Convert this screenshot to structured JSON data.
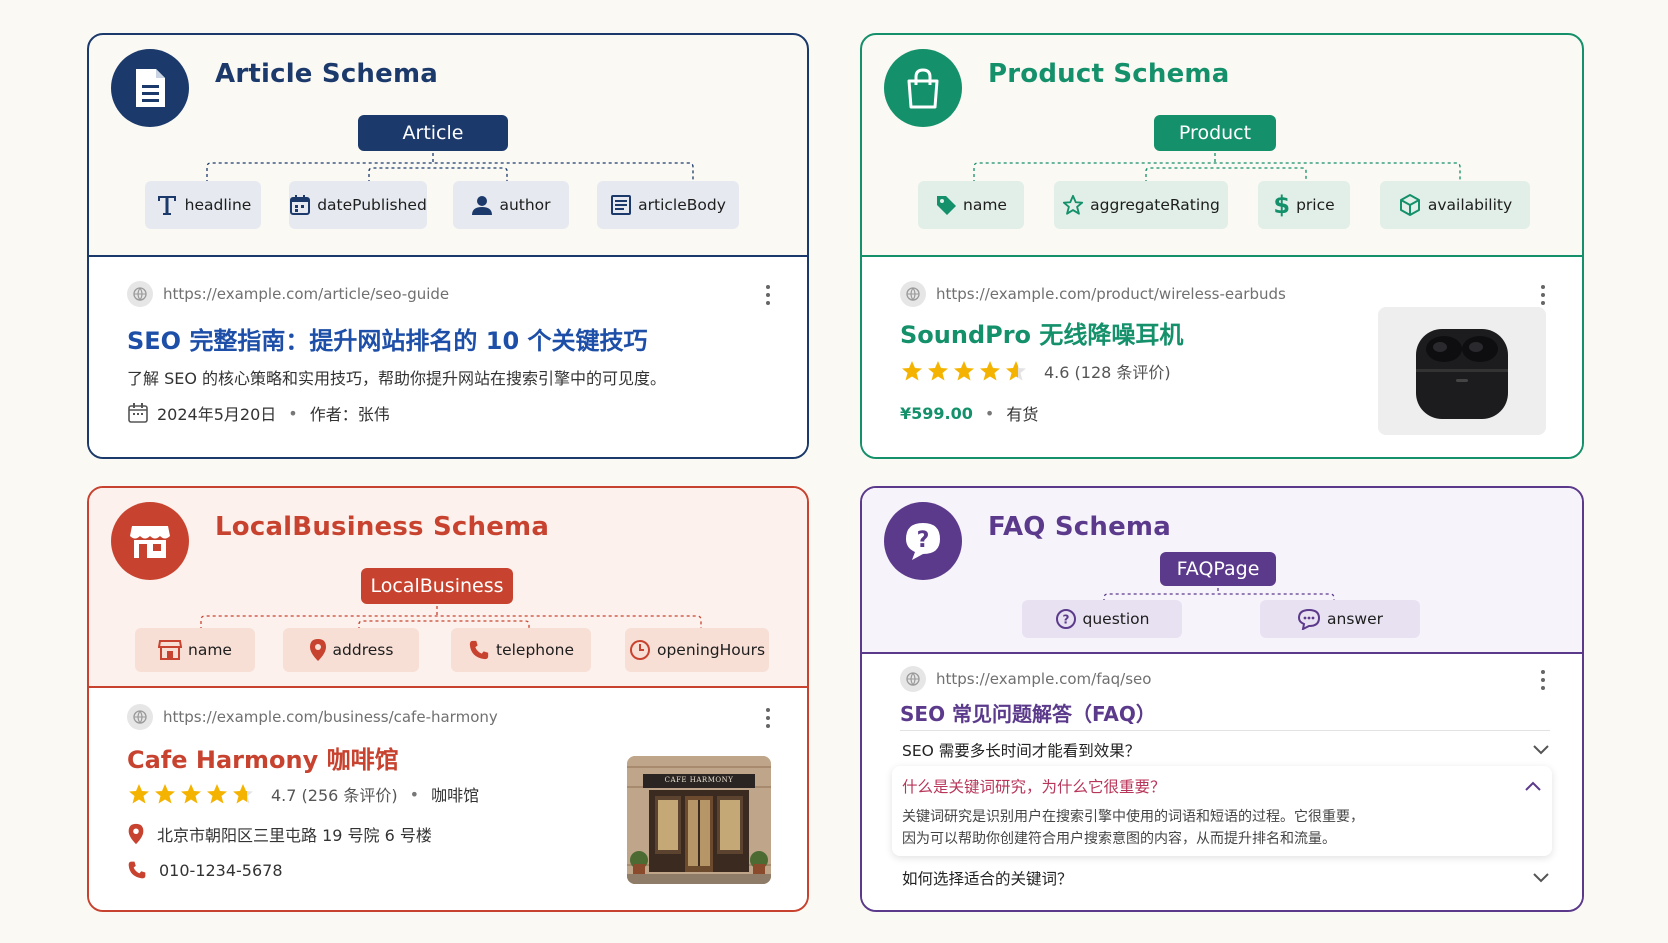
{
  "article": {
    "title": "Article Schema",
    "root": "Article",
    "chips": [
      "headline",
      "datePublished",
      "author",
      "articleBody"
    ],
    "url": "https://example.com/article/seo-guide",
    "result_title": "SEO 完整指南：提升网站排名的 10 个关键技巧",
    "desc": "了解 SEO 的核心策略和实用技巧，帮助你提升网站在搜索引擎中的可见度。",
    "date": "2024年5月20日",
    "author": "作者：张伟",
    "color": "#1b3a6b"
  },
  "product": {
    "title": "Product Schema",
    "root": "Product",
    "chips": [
      "name",
      "aggregateRating",
      "price",
      "availability"
    ],
    "url": "https://example.com/product/wireless-earbuds",
    "result_title": "SoundPro 无线降噪耳机",
    "rating": "4.6 (128 条评价)",
    "rating_value": 4.6,
    "price": "¥599.00",
    "stock": "有货",
    "color": "#14906a"
  },
  "local": {
    "title": "LocalBusiness Schema",
    "root": "LocalBusiness",
    "chips": [
      "name",
      "address",
      "telephone",
      "openingHours"
    ],
    "url": "https://example.com/business/cafe-harmony",
    "result_title": "Cafe Harmony 咖啡馆",
    "rating": "4.7 (256 条评价)",
    "rating_value": 4.7,
    "category": "咖啡馆",
    "address": "北京市朝阳区三里屯路 19 号院 6 号楼",
    "phone": "010-1234-5678",
    "sign": "CAFE HARMONY",
    "color": "#c8432f"
  },
  "faq": {
    "title": "FAQ Schema",
    "root": "FAQPage",
    "chips": [
      "question",
      "answer"
    ],
    "url": "https://example.com/faq/seo",
    "result_title": "SEO 常见问题解答（FAQ）",
    "q1": "SEO 需要多长时间才能看到效果？",
    "q2": "什么是关键词研究，为什么它很重要？",
    "a2_line1": "关键词研究是识别用户在搜索引擎中使用的词语和短语的过程。它很重要，",
    "a2_line2": "因为可以帮助你创建符合用户搜索意图的内容，从而提升排名和流量。",
    "q3": "如何选择适合的关键词？",
    "color": "#5b3a8c"
  }
}
